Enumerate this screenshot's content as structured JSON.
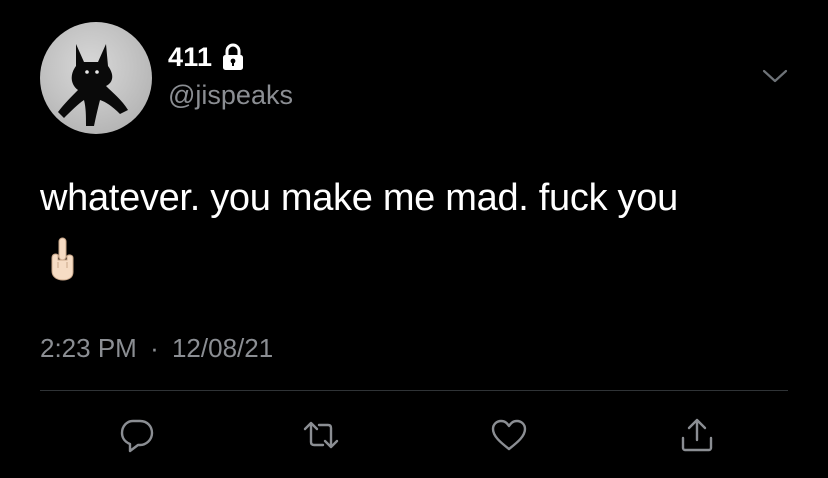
{
  "author": {
    "display_name": "411",
    "handle": "@jispeaks",
    "protected_icon": "lock-icon",
    "avatar": "black-cat-avatar"
  },
  "tweet": {
    "text": "whatever. you make me mad. fuck you",
    "emoji": "🖕🏻",
    "time": "2:23 PM",
    "separator": "·",
    "date": "12/08/21"
  },
  "actions": {
    "reply_icon": "reply-icon",
    "retweet_icon": "retweet-icon",
    "like_icon": "heart-icon",
    "share_icon": "share-icon"
  },
  "menu_icon": "chevron-down-icon",
  "colors": {
    "background": "#000000",
    "text_primary": "#ffffff",
    "text_secondary": "#8b8e93",
    "divider": "#2f3336"
  }
}
